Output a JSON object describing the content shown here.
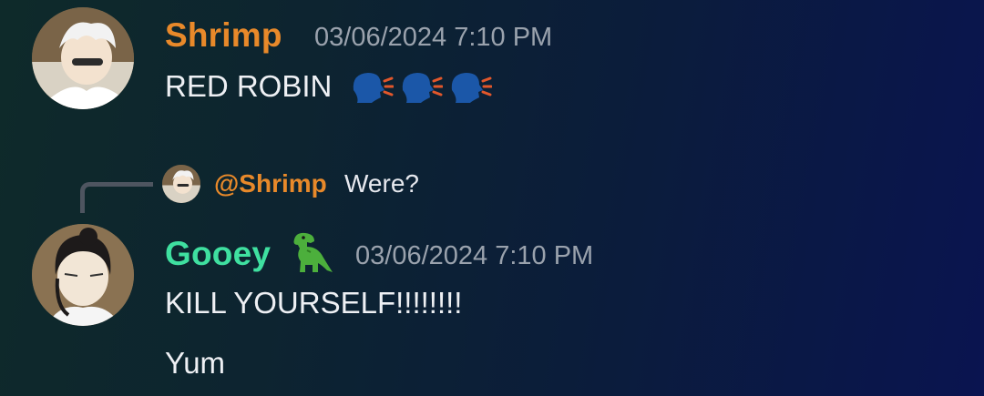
{
  "colors": {
    "shrimp_name": "#E8892A",
    "gooey_name": "#3FE0A0",
    "timestamp": "#9AA2AD",
    "reply_line": "#4E5560"
  },
  "messages": [
    {
      "author": "Shrimp",
      "timestamp": "03/06/2024 7:10 PM",
      "avatar_icon": "avatar-white-haired-character",
      "text": "RED ROBIN",
      "emojis": [
        "speaking-head-icon",
        "speaking-head-icon",
        "speaking-head-icon"
      ]
    },
    {
      "reply": {
        "mention": "@Shrimp",
        "text": "Were?"
      },
      "author": "Gooey",
      "author_badge_icon": "t-rex-icon",
      "timestamp": "03/06/2024 7:10 PM",
      "avatar_icon": "avatar-dark-haired-character",
      "lines": [
        "KILL YOURSELF!!!!!!!!",
        "Yum"
      ]
    }
  ]
}
